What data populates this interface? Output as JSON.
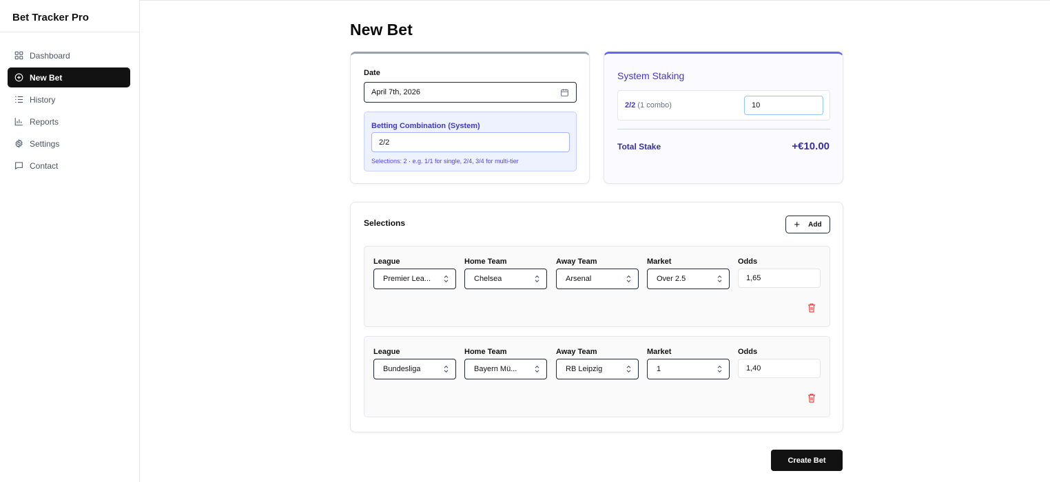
{
  "app": {
    "title": "Bet Tracker Pro"
  },
  "sidebar": {
    "items": [
      {
        "label": "Dashboard",
        "icon": "dashboard-icon",
        "active": false
      },
      {
        "label": "New Bet",
        "icon": "plus-circle-icon",
        "active": true
      },
      {
        "label": "History",
        "icon": "list-icon",
        "active": false
      },
      {
        "label": "Reports",
        "icon": "bar-chart-icon",
        "active": false
      },
      {
        "label": "Settings",
        "icon": "gear-icon",
        "active": false
      },
      {
        "label": "Contact",
        "icon": "message-icon",
        "active": false
      }
    ]
  },
  "main": {
    "title": "New Bet",
    "date": {
      "label": "Date",
      "value": "April 7th, 2026"
    },
    "combination": {
      "label": "Betting Combination (System)",
      "value": "2/2",
      "hint": "Selections: 2  ·  e.g. 1/1 for single, 2/4, 3/4 for multi-tier"
    },
    "staking": {
      "title": "System Staking",
      "combo_name": "2/2",
      "combo_count": "(1 combo)",
      "stake_value": "10",
      "total_label": "Total Stake",
      "total_value": "+€10.00"
    },
    "selections": {
      "title": "Selections",
      "add_label": "Add",
      "labels": {
        "league": "League",
        "home": "Home Team",
        "away": "Away Team",
        "market": "Market",
        "odds": "Odds"
      },
      "rows": [
        {
          "league": "Premier Lea...",
          "home": "Chelsea",
          "away": "Arsenal",
          "market": "Over 2.5",
          "odds": "1,65"
        },
        {
          "league": "Bundesliga",
          "home": "Bayern Mü...",
          "away": "RB Leipzig",
          "market": "1",
          "odds": "1,40"
        }
      ]
    },
    "create_label": "Create Bet"
  },
  "colors": {
    "accent": "#4338ca",
    "dark": "#121212",
    "danger": "#ef4444"
  }
}
